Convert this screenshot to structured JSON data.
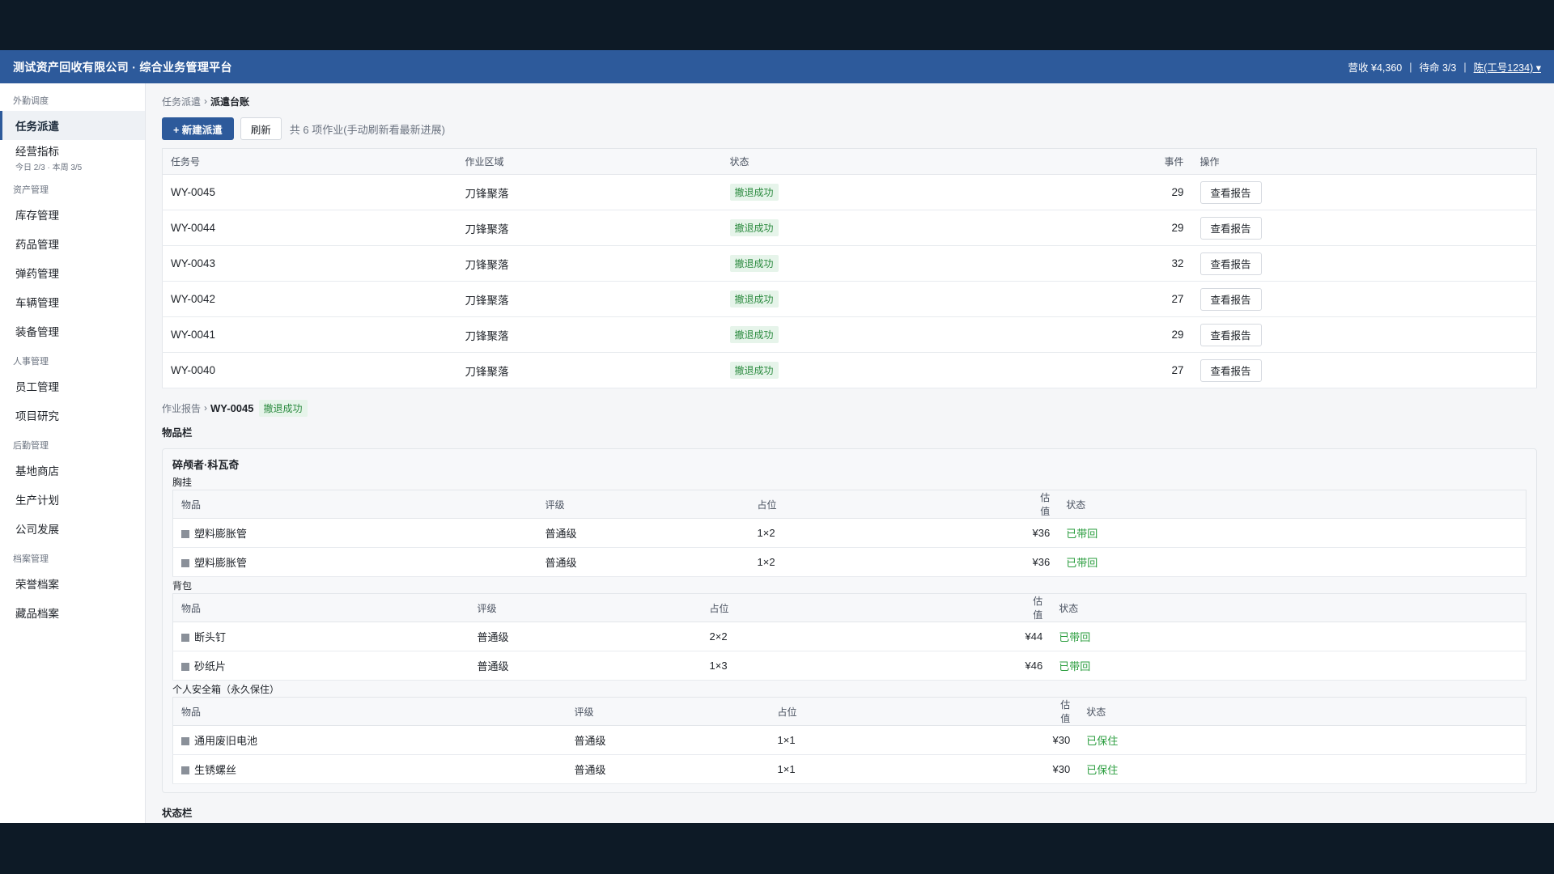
{
  "header": {
    "title": "测试资产回收有限公司 · 综合业务管理平台",
    "revenue": "营收 ¥4,360",
    "lives": "待命 3/3",
    "user": "陈(工号1234) ▾"
  },
  "sidebar": {
    "groups": [
      {
        "label": "外勤调度",
        "items": [
          {
            "label": "任务派遣",
            "active": true
          },
          {
            "label": "经营指标",
            "sub": "今日 2/3 · 本周 3/5"
          }
        ]
      },
      {
        "label": "资产管理",
        "items": [
          {
            "label": "库存管理"
          },
          {
            "label": "药品管理"
          },
          {
            "label": "弹药管理"
          },
          {
            "label": "车辆管理"
          },
          {
            "label": "装备管理"
          }
        ]
      },
      {
        "label": "人事管理",
        "items": [
          {
            "label": "员工管理"
          },
          {
            "label": "项目研究"
          }
        ]
      },
      {
        "label": "后勤管理",
        "items": [
          {
            "label": "基地商店"
          },
          {
            "label": "生产计划"
          },
          {
            "label": "公司发展"
          }
        ]
      },
      {
        "label": "档案管理",
        "items": [
          {
            "label": "荣誉档案"
          },
          {
            "label": "藏品档案"
          }
        ]
      }
    ]
  },
  "breadcrumb": {
    "parent": "任务派遣",
    "current": "派遣台账"
  },
  "toolbar": {
    "new_label": "+ 新建派遣",
    "refresh_label": "刷新",
    "info": "共 6 项作业(手动刷新看最新进展)"
  },
  "tasks": {
    "columns": [
      "任务号",
      "作业区域",
      "状态",
      "事件",
      "操作"
    ],
    "rows": [
      {
        "id": "WY-0045",
        "area": "刀锋聚落",
        "status": "撤退成功",
        "events": "29",
        "action": "查看报告"
      },
      {
        "id": "WY-0044",
        "area": "刀锋聚落",
        "status": "撤退成功",
        "events": "29",
        "action": "查看报告"
      },
      {
        "id": "WY-0043",
        "area": "刀锋聚落",
        "status": "撤退成功",
        "events": "32",
        "action": "查看报告"
      },
      {
        "id": "WY-0042",
        "area": "刀锋聚落",
        "status": "撤退成功",
        "events": "27",
        "action": "查看报告"
      },
      {
        "id": "WY-0041",
        "area": "刀锋聚落",
        "status": "撤退成功",
        "events": "29",
        "action": "查看报告"
      },
      {
        "id": "WY-0040",
        "area": "刀锋聚落",
        "status": "撤退成功",
        "events": "27",
        "action": "查看报告"
      }
    ]
  },
  "report": {
    "crumb_parent": "作业报告",
    "task_id": "WY-0045",
    "status": "撤退成功",
    "inventory_title": "物品栏",
    "operator": "碎颅者·科瓦奇",
    "status_title": "状态栏",
    "columns": [
      "物品",
      "评级",
      "占位",
      "估值",
      "状态"
    ],
    "slots": [
      {
        "title": "胸挂",
        "items": [
          {
            "name": "塑料膨胀管",
            "grade": "普通级",
            "size": "1×2",
            "value": "¥36",
            "state": "已带回"
          },
          {
            "name": "塑料膨胀管",
            "grade": "普通级",
            "size": "1×2",
            "value": "¥36",
            "state": "已带回"
          }
        ]
      },
      {
        "title": "背包",
        "items": [
          {
            "name": "断头钉",
            "grade": "普通级",
            "size": "2×2",
            "value": "¥44",
            "state": "已带回"
          },
          {
            "name": "砂纸片",
            "grade": "普通级",
            "size": "1×3",
            "value": "¥46",
            "state": "已带回"
          }
        ]
      },
      {
        "title": "个人安全箱（永久保住）",
        "items": [
          {
            "name": "通用废旧电池",
            "grade": "普通级",
            "size": "1×1",
            "value": "¥30",
            "state": "已保住"
          },
          {
            "name": "生锈螺丝",
            "grade": "普通级",
            "size": "1×1",
            "value": "¥30",
            "state": "已保住"
          }
        ]
      }
    ]
  }
}
